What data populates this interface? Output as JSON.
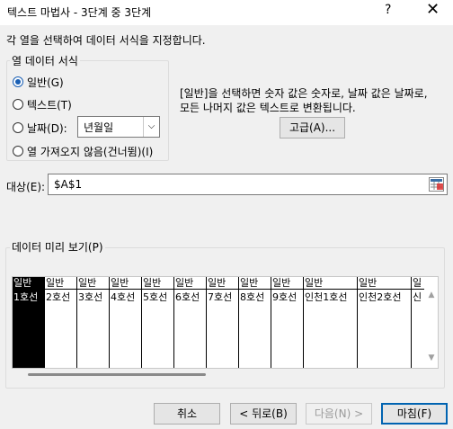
{
  "window": {
    "title": "텍스트 마법사 - 3단계 중 3단계",
    "help_label": "?",
    "close_label": "✕"
  },
  "description": "각 열을 선택하여 데이터 서식을 지정합니다.",
  "column_format": {
    "group_label": "열 데이터 서식",
    "options": [
      {
        "label": "일반(G)",
        "checked": true
      },
      {
        "label": "텍스트(T)",
        "checked": false
      },
      {
        "label": "날짜(D):",
        "checked": false
      },
      {
        "label": "열 가져오지 않음(건너뜀)(I)",
        "checked": false
      }
    ],
    "date_value": "년월일"
  },
  "info_text": {
    "line1": "[일반]을 선택하면 숫자 값은 숫자로, 날짜 값은 날짜로,",
    "line2": "모든 나머지 값은 텍스트로 변환됩니다."
  },
  "advanced_button": "고급(A)...",
  "target": {
    "label": "대상(E):",
    "value": "$A$1"
  },
  "preview": {
    "label": "데이터 미리 보기(P)",
    "columns": [
      {
        "header": "일반",
        "value": "1호선"
      },
      {
        "header": "일반",
        "value": "2호선"
      },
      {
        "header": "일반",
        "value": "3호선"
      },
      {
        "header": "일반",
        "value": "4호선"
      },
      {
        "header": "일반",
        "value": "5호선"
      },
      {
        "header": "일반",
        "value": "6호선"
      },
      {
        "header": "일반",
        "value": "7호선"
      },
      {
        "header": "일반",
        "value": "8호선"
      },
      {
        "header": "일반",
        "value": "9호선"
      },
      {
        "header": "일반",
        "value": "인천1호선"
      },
      {
        "header": "일반",
        "value": "인천2호선"
      },
      {
        "header": "일",
        "value": "신"
      }
    ]
  },
  "buttons": {
    "cancel": "취소",
    "back": "< 뒤로(B)",
    "next": "다음(N) >",
    "finish": "마침(F)"
  }
}
